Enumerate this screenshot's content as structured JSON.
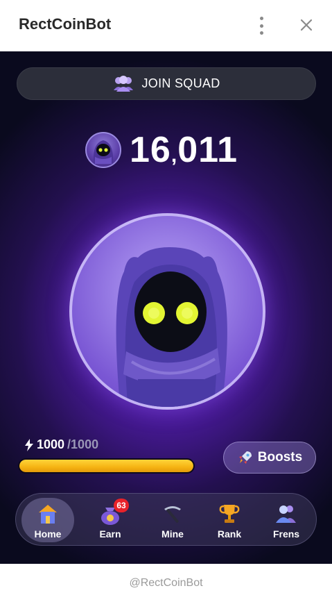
{
  "header": {
    "title": "RectCoinBot"
  },
  "join": {
    "label": "JOIN SQUAD",
    "icon": "group-icon"
  },
  "balance": {
    "amount": "16",
    "comma": ",",
    "amount_rest": "011"
  },
  "energy": {
    "current": "1000",
    "max": "/1000",
    "level": 1.0
  },
  "boosts": {
    "label": "Boosts",
    "icon": "rocket-icon"
  },
  "nav": {
    "items": [
      {
        "label": "Home",
        "icon": "home-icon",
        "active": true
      },
      {
        "label": "Earn",
        "icon": "coin-bag-icon",
        "badge": "63"
      },
      {
        "label": "Mine",
        "icon": "pickaxe-icon"
      },
      {
        "label": "Rank",
        "icon": "trophy-icon"
      },
      {
        "label": "Frens",
        "icon": "friends-icon"
      }
    ]
  },
  "footer": {
    "text": "@RectCoinBot"
  },
  "colors": {
    "accent": "#6a2bd2",
    "energy": "#f5b313",
    "badge": "#e8222a"
  }
}
